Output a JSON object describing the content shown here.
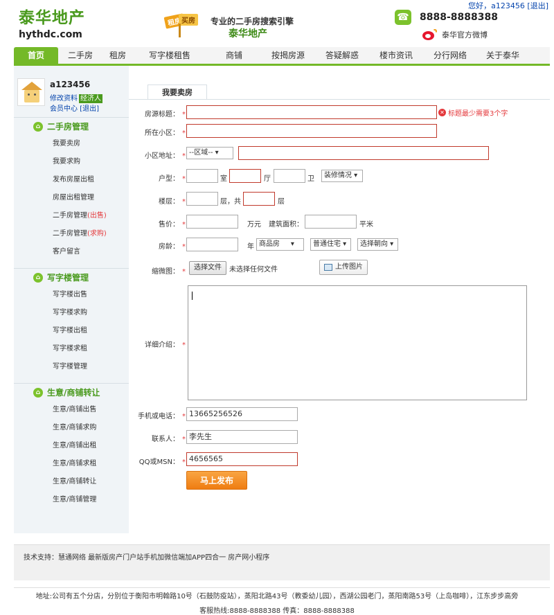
{
  "topbar": {
    "greeting": "您好，a123456",
    "logout": "[退出]"
  },
  "logo": {
    "cn": "泰华地产",
    "en": "hythdc.com"
  },
  "banner": {
    "sign_left": "租房",
    "sign_right": "买房",
    "tagline": "专业的二手房搜索引擎",
    "brand": "泰华地产"
  },
  "contact": {
    "phone": "8888-8888388",
    "weibo": "泰华官方微博"
  },
  "nav": [
    "首页",
    "二手房",
    "租房",
    "写字楼租售",
    "商铺",
    "按揭房源",
    "答疑解惑",
    "楼市资讯",
    "分行网络",
    "关于泰华"
  ],
  "user": {
    "name": "a123456",
    "edit": "修改资料",
    "role": "经济人",
    "center": "会员中心",
    "logout": "[退出]"
  },
  "sidebar": {
    "sections": [
      {
        "title": "二手房管理",
        "items": [
          "我要卖房",
          "我要求购",
          "发布房屋出租",
          "房屋出租管理",
          "二手房管理",
          "二手房管理",
          "客户留言"
        ],
        "tags": [
          "",
          "",
          "",
          "",
          "(出售)",
          "(求购)",
          ""
        ]
      },
      {
        "title": "写字楼管理",
        "items": [
          "写字楼出售",
          "写字楼求购",
          "写字楼出租",
          "写字楼求租",
          "写字楼管理"
        ]
      },
      {
        "title": "生意/商铺转让",
        "items": [
          "生意/商铺出售",
          "生意/商铺求购",
          "生意/商铺出租",
          "生意/商铺求租",
          "生意/商铺转让",
          "生意/商铺管理"
        ]
      }
    ]
  },
  "form": {
    "tab": "我要卖房",
    "required_mark": "*",
    "labels": {
      "title": "房源标题：",
      "community": "所在小区：",
      "address": "小区地址：",
      "layout": "户型：",
      "floor": "楼层：",
      "price": "售价：",
      "age": "房龄：",
      "thumb": "缩微图：",
      "detail": "详细介绍：",
      "phone": "手机或电话：",
      "contact": "联系人：",
      "qq": "QQ或MSN："
    },
    "error_title": "标题最少需要3个字",
    "district_select": "--区域--",
    "units": {
      "room": "室",
      "hall": "厅",
      "bath": "卫",
      "floor_unit": "层，共",
      "floor_total": "层",
      "wan": "万元",
      "area_label": "建筑面积：",
      "sqm": "平米",
      "year": "年"
    },
    "decoration_select": "装修情况",
    "property_type": "商品房",
    "residence_type": "普通住宅",
    "orientation": "选择朝向",
    "file_button": "选择文件",
    "no_file": "未选择任何文件",
    "upload_button": "上传图片",
    "phone_value": "13665256526",
    "contact_value": "李先生",
    "qq_value": "4656565",
    "submit": "马上发布"
  },
  "footer": {
    "support": "技术支持：慧通网络    最新版房产门户站手机加微信端加APP四合一    房产网小程序",
    "address": "地址:公司有五个分店，分别位于衡阳市明翰路10号（石鼓防疫站），蒸阳北路43号（教委幼儿园），西湖公园老门，蒸阳南路53号（上岛咖啡），江东步步高旁",
    "hotline": "客服热线:8888-8888388 传真：8888-8888388"
  }
}
